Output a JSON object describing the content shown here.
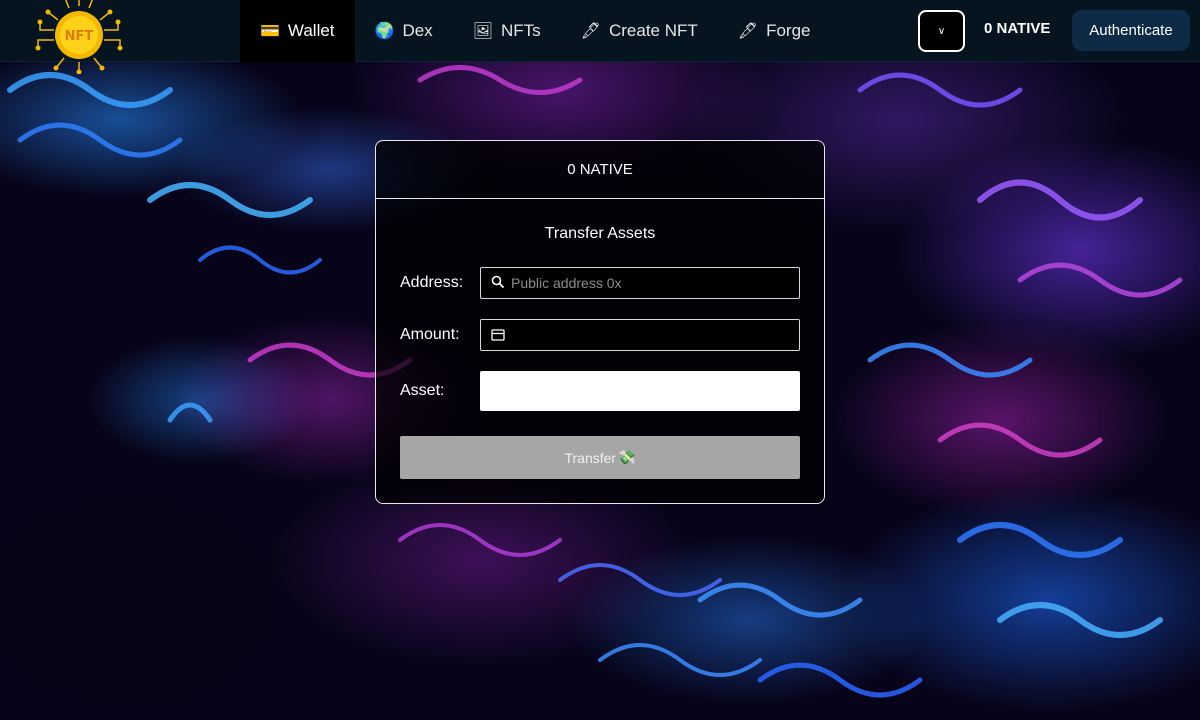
{
  "nav": {
    "items": [
      {
        "icon": "💳",
        "label": "Wallet",
        "active": true
      },
      {
        "icon": "🌍",
        "label": "Dex",
        "active": false
      },
      {
        "icon": "🖼",
        "label": "NFTs",
        "active": false
      },
      {
        "icon": "🖋",
        "label": "Create NFT",
        "active": false
      },
      {
        "icon": "🖋",
        "label": "Forge",
        "active": false
      }
    ]
  },
  "header": {
    "logo_text": "NFT",
    "chain_select_value": "",
    "balance": "0 NATIVE",
    "auth_label": "Authenticate"
  },
  "card": {
    "balance": "0 NATIVE",
    "title": "Transfer Assets",
    "address_label": "Address:",
    "address_placeholder": "Public address 0x",
    "amount_label": "Amount:",
    "asset_label": "Asset:",
    "transfer_label": "Transfer",
    "transfer_icon": "💸"
  },
  "colors": {
    "header_bg": "#06141f",
    "auth_bg": "#0d2a47",
    "logo_gold": "#f5b800",
    "button_disabled": "#a6a6a6"
  }
}
